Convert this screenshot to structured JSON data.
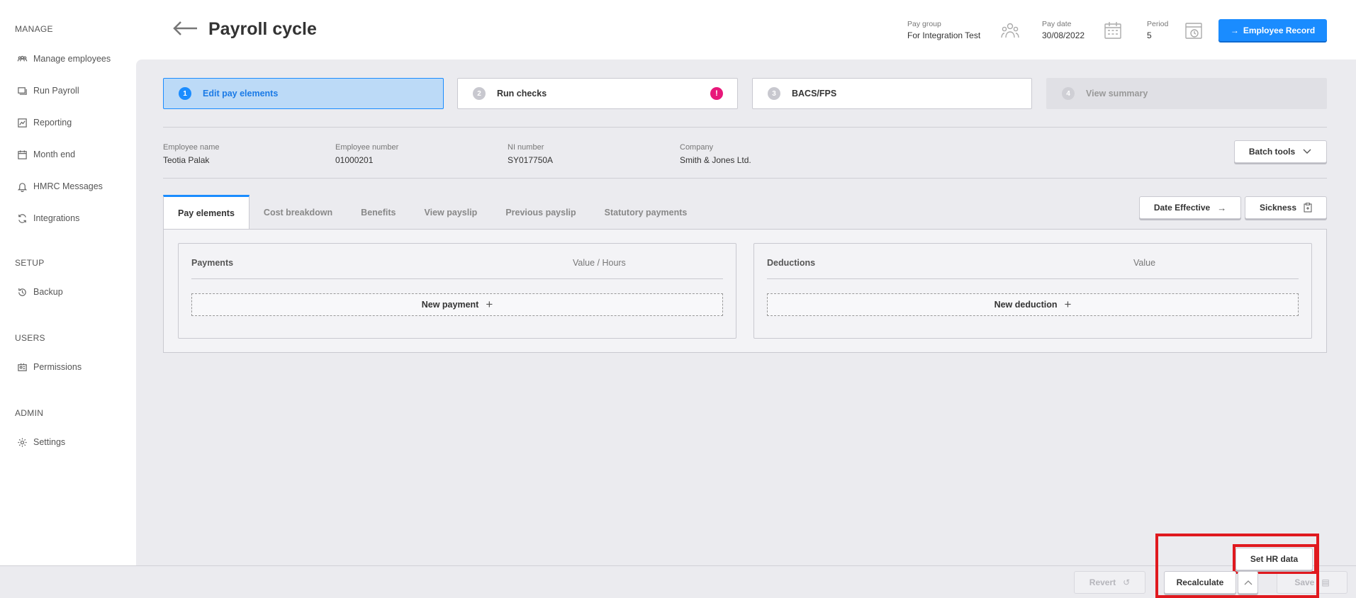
{
  "sidebar": {
    "sections": [
      {
        "title": "MANAGE",
        "items": [
          {
            "label": "Manage employees",
            "icon": "people-icon"
          },
          {
            "label": "Run Payroll",
            "icon": "stack-icon"
          },
          {
            "label": "Reporting",
            "icon": "chart-icon"
          },
          {
            "label": "Month end",
            "icon": "calendar-icon"
          },
          {
            "label": "HMRC Messages",
            "icon": "bell-icon"
          },
          {
            "label": "Integrations",
            "icon": "sync-icon"
          }
        ]
      },
      {
        "title": "SETUP",
        "items": [
          {
            "label": "Backup",
            "icon": "history-icon"
          }
        ]
      },
      {
        "title": "USERS",
        "items": [
          {
            "label": "Permissions",
            "icon": "id-card-icon"
          }
        ]
      },
      {
        "title": "ADMIN",
        "items": [
          {
            "label": "Settings",
            "icon": "gear-icon"
          }
        ]
      }
    ]
  },
  "header": {
    "title": "Payroll cycle",
    "pay_group": {
      "label": "Pay group",
      "value": "For Integration Test"
    },
    "pay_date": {
      "label": "Pay date",
      "value": "30/08/2022"
    },
    "period": {
      "label": "Period",
      "value": "5"
    },
    "employee_record_button": "Employee Record"
  },
  "steps": [
    {
      "number": "1",
      "label": "Edit pay elements",
      "state": "active"
    },
    {
      "number": "2",
      "label": "Run checks",
      "state": "normal",
      "alert": "!"
    },
    {
      "number": "3",
      "label": "BACS/FPS",
      "state": "normal"
    },
    {
      "number": "4",
      "label": "View summary",
      "state": "disabled"
    }
  ],
  "employee": {
    "name": {
      "label": "Employee name",
      "value": "Teotia Palak"
    },
    "number": {
      "label": "Employee number",
      "value": "01000201"
    },
    "ni": {
      "label": "NI number",
      "value": "SY017750A"
    },
    "company": {
      "label": "Company",
      "value": "Smith & Jones Ltd."
    }
  },
  "batch_tools_button": "Batch tools",
  "tabs": [
    "Pay elements",
    "Cost breakdown",
    "Benefits",
    "View payslip",
    "Previous payslip",
    "Statutory payments"
  ],
  "date_effective_button": "Date Effective",
  "sickness_button": "Sickness",
  "payments": {
    "title": "Payments",
    "value_header": "Value / Hours",
    "new_label": "New payment"
  },
  "deductions": {
    "title": "Deductions",
    "value_header": "Value",
    "new_label": "New deduction"
  },
  "footer": {
    "set_hr_data": "Set HR data",
    "revert": "Revert",
    "recalculate": "Recalculate",
    "save": "Save"
  },
  "colors": {
    "accent": "#1a8cff",
    "alert": "#e8177a",
    "highlight": "#e0191f"
  }
}
